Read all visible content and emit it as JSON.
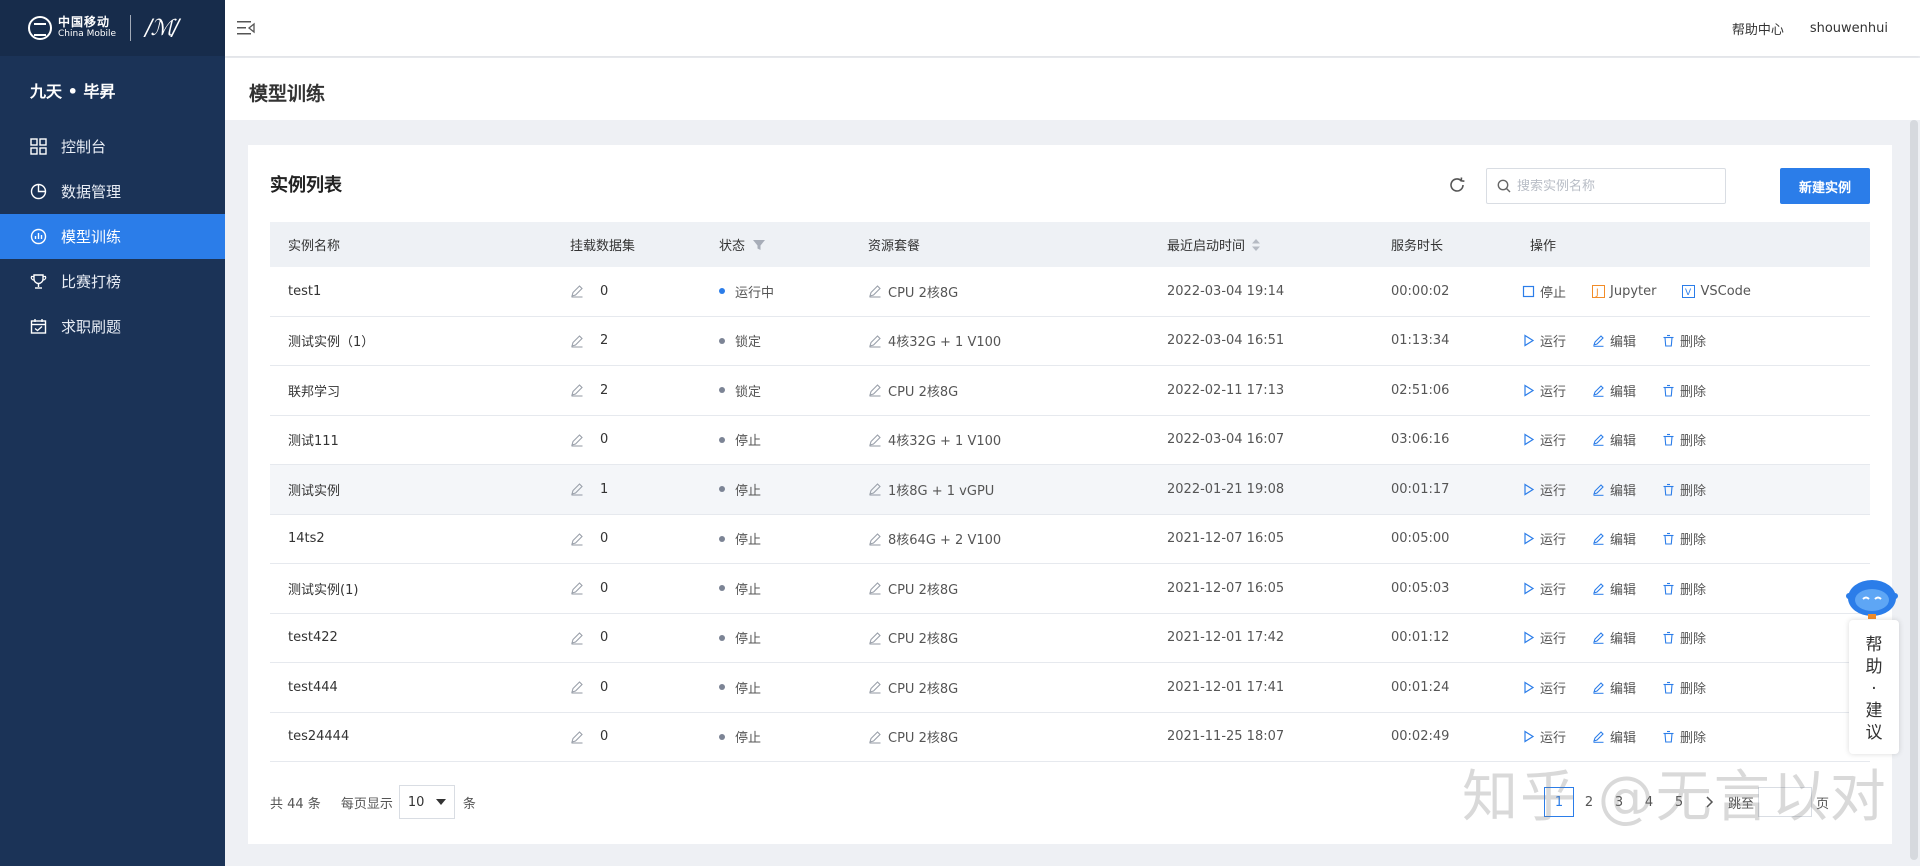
{
  "sidebar": {
    "logo_cn": "中国移动",
    "logo_en": "China Mobile",
    "logo_sign": "/ℳ/",
    "brand": "九天 • 毕昇",
    "items": [
      {
        "label": "控制台",
        "icon": "dashboard-grid-icon"
      },
      {
        "label": "数据管理",
        "icon": "pie-chart-icon"
      },
      {
        "label": "模型训练",
        "icon": "model-chart-icon",
        "active": true
      },
      {
        "label": "比赛打榜",
        "icon": "trophy-icon"
      },
      {
        "label": "求职刷题",
        "icon": "calendar-icon"
      }
    ]
  },
  "header": {
    "help_center": "帮助中心",
    "username": "shouwenhui"
  },
  "page": {
    "title": "模型训练"
  },
  "card": {
    "title": "实例列表",
    "search_placeholder": "搜索实例名称",
    "new_button": "新建实例"
  },
  "table": {
    "headers": [
      "实例名称",
      "挂载数据集",
      "状态",
      "资源套餐",
      "最近启动时间",
      "服务时长",
      "操作"
    ],
    "rows": [
      {
        "name": "test1",
        "datasets": "0",
        "status": "运行中",
        "running": true,
        "resource": "CPU 2核8G",
        "started": "2022-03-04 19:14",
        "duration": "00:00:02"
      },
      {
        "name": "测试实例（1）",
        "datasets": "2",
        "status": "锁定",
        "resource": "4核32G + 1 V100",
        "started": "2022-03-04 16:51",
        "duration": "01:13:34"
      },
      {
        "name": "联邦学习",
        "datasets": "2",
        "status": "锁定",
        "resource": "CPU 2核8G",
        "started": "2022-02-11 17:13",
        "duration": "02:51:06"
      },
      {
        "name": "测试111",
        "datasets": "0",
        "status": "停止",
        "resource": "4核32G + 1 V100",
        "started": "2022-03-04 16:07",
        "duration": "03:06:16"
      },
      {
        "name": "测试实例",
        "datasets": "1",
        "status": "停止",
        "resource": "1核8G + 1 vGPU",
        "started": "2022-01-21 19:08",
        "duration": "00:01:17",
        "highlight": true
      },
      {
        "name": "14ts2",
        "datasets": "0",
        "status": "停止",
        "resource": "8核64G + 2 V100",
        "started": "2021-12-07 16:05",
        "duration": "00:05:00"
      },
      {
        "name": "测试实例(1)",
        "datasets": "0",
        "status": "停止",
        "resource": "CPU 2核8G",
        "started": "2021-12-07 16:05",
        "duration": "00:05:03"
      },
      {
        "name": "test422",
        "datasets": "0",
        "status": "停止",
        "resource": "CPU 2核8G",
        "started": "2021-12-01 17:42",
        "duration": "00:01:12"
      },
      {
        "name": "test444",
        "datasets": "0",
        "status": "停止",
        "resource": "CPU 2核8G",
        "started": "2021-12-01 17:41",
        "duration": "00:01:24"
      },
      {
        "name": "tes24444",
        "datasets": "0",
        "status": "停止",
        "resource": "CPU 2核8G",
        "started": "2021-11-25 18:07",
        "duration": "00:02:49"
      }
    ],
    "actions_running": [
      "停止",
      "Jupyter",
      "VSCode"
    ],
    "actions_stopped": [
      "运行",
      "编辑",
      "删除"
    ]
  },
  "pagination": {
    "total_text": "共 44 条",
    "per_page_label": "每页显示",
    "per_page_value": "10",
    "per_page_unit": "条",
    "pages": [
      "1",
      "2",
      "3",
      "4",
      "5"
    ],
    "current": "1",
    "jump_label": "跳至",
    "page_unit": "页"
  },
  "watermark": "知乎 @无言以对",
  "help_widget": {
    "label_lines": [
      "帮",
      "助",
      "·",
      "建",
      "议"
    ]
  },
  "colors": {
    "sidebar_bg": "#1b3357",
    "accent": "#2b7de9"
  }
}
